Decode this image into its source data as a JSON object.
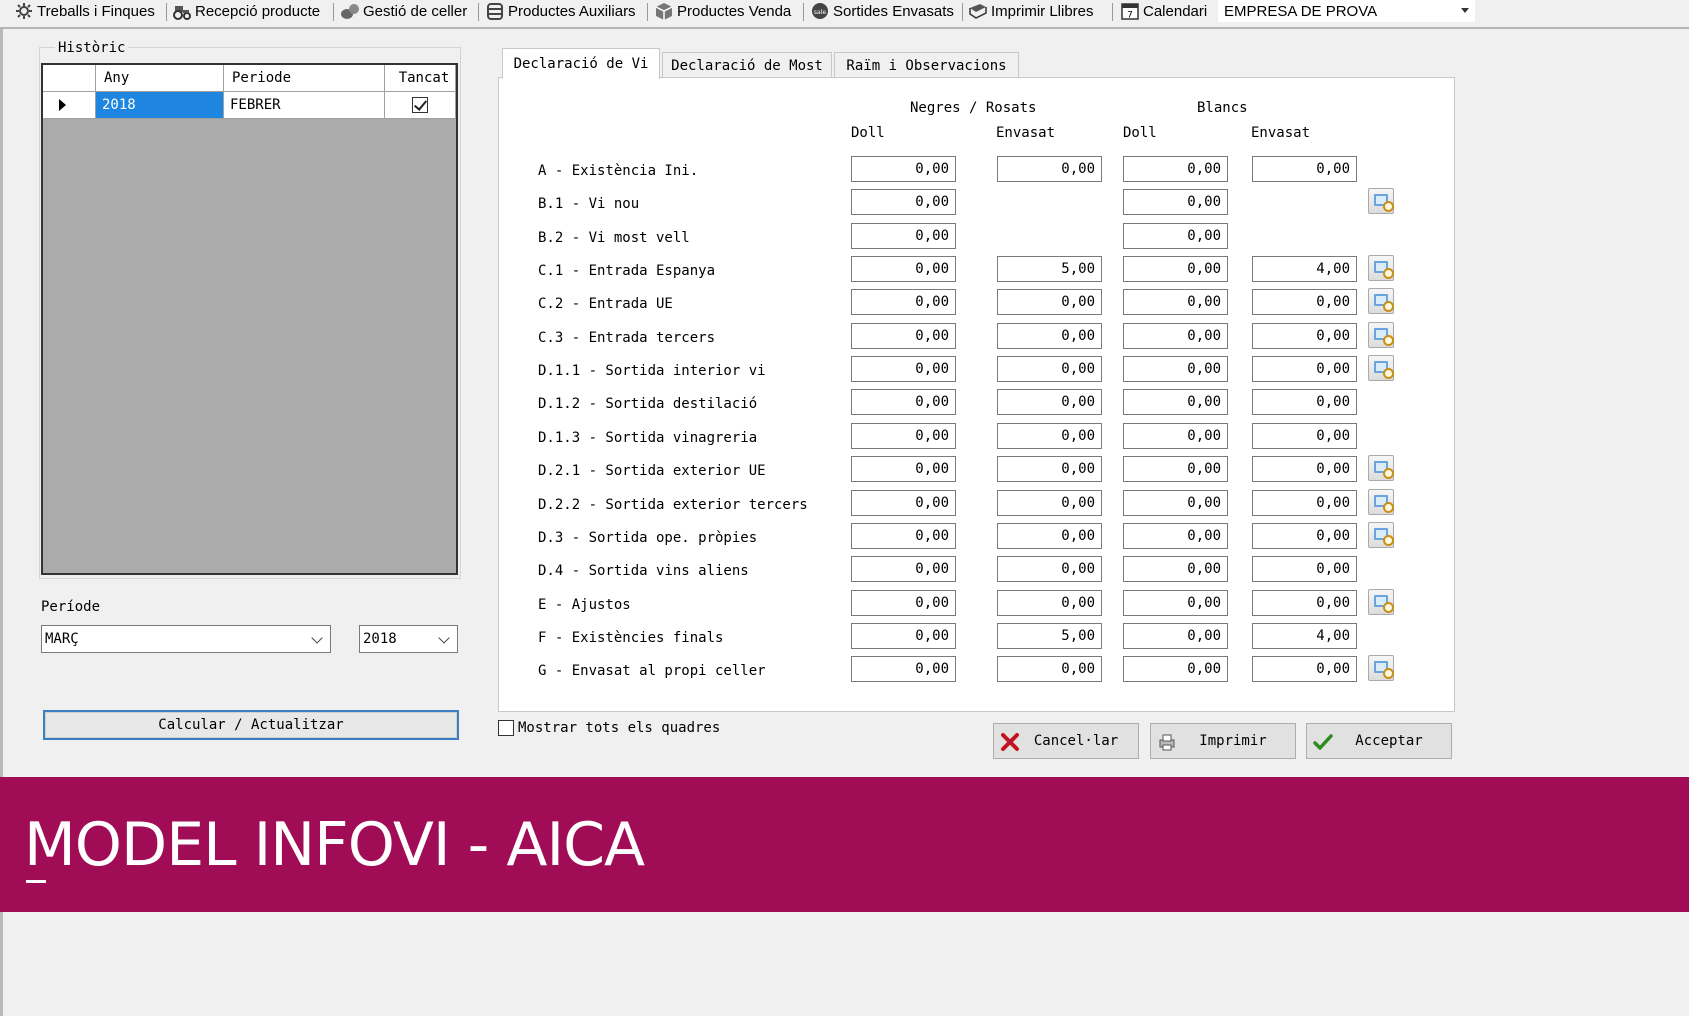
{
  "toolbar": {
    "items": [
      {
        "label": "Treballs i Finques",
        "icon": "gear-leaf-icon"
      },
      {
        "label": "Recepció producte",
        "icon": "tractor-icon"
      },
      {
        "label": "Gestió de celler",
        "icon": "barrels-icon"
      },
      {
        "label": "Productes Auxiliars",
        "icon": "container-icon"
      },
      {
        "label": "Productes Venda",
        "icon": "box-icon"
      },
      {
        "label": "Sortides Envasats",
        "icon": "sale-icon"
      },
      {
        "label": "Imprimir Llibres",
        "icon": "book-icon"
      },
      {
        "label": "Calendari",
        "icon": "calendar-icon",
        "calendar_day": "7"
      }
    ],
    "company": "EMPRESA DE PROVA"
  },
  "historic": {
    "title": "Històric",
    "headers": [
      "Any",
      "Periode",
      "Tancat"
    ],
    "rows": [
      {
        "year": "2018",
        "period": "FEBRER",
        "closed": true
      }
    ]
  },
  "periode": {
    "label": "Període",
    "month": "MARÇ",
    "year": "2018"
  },
  "calc_button": "Calcular / Actualitzar",
  "tabs": [
    "Declaració de Vi",
    "Declaració de Most",
    "Raïm i Observacions"
  ],
  "declaration": {
    "group_headers": [
      "Negres / Rosats",
      "Blancs"
    ],
    "column_headers": [
      "Doll",
      "Envasat",
      "Doll",
      "Envasat"
    ],
    "rows": [
      {
        "label": "A - Existència Ini.",
        "values": [
          "0,00",
          "0,00",
          "0,00",
          "0,00"
        ],
        "lookup": false
      },
      {
        "label": "B.1 - Vi nou",
        "values": [
          "0,00",
          null,
          "0,00",
          null
        ],
        "lookup": true
      },
      {
        "label": "B.2 - Vi most vell",
        "values": [
          "0,00",
          null,
          "0,00",
          null
        ],
        "lookup": false
      },
      {
        "label": "C.1 - Entrada Espanya",
        "values": [
          "0,00",
          "5,00",
          "0,00",
          "4,00"
        ],
        "lookup": true
      },
      {
        "label": "C.2 - Entrada UE",
        "values": [
          "0,00",
          "0,00",
          "0,00",
          "0,00"
        ],
        "lookup": true
      },
      {
        "label": "C.3 - Entrada tercers",
        "values": [
          "0,00",
          "0,00",
          "0,00",
          "0,00"
        ],
        "lookup": true
      },
      {
        "label": "D.1.1 - Sortida interior vi",
        "values": [
          "0,00",
          "0,00",
          "0,00",
          "0,00"
        ],
        "lookup": true
      },
      {
        "label": "D.1.2 - Sortida destilació",
        "values": [
          "0,00",
          "0,00",
          "0,00",
          "0,00"
        ],
        "lookup": false
      },
      {
        "label": "D.1.3 - Sortida vinagreria",
        "values": [
          "0,00",
          "0,00",
          "0,00",
          "0,00"
        ],
        "lookup": false
      },
      {
        "label": "D.2.1 - Sortida exterior UE",
        "values": [
          "0,00",
          "0,00",
          "0,00",
          "0,00"
        ],
        "lookup": true
      },
      {
        "label": "D.2.2 - Sortida exterior tercers",
        "values": [
          "0,00",
          "0,00",
          "0,00",
          "0,00"
        ],
        "lookup": true
      },
      {
        "label": "D.3 - Sortida ope. pròpies",
        "values": [
          "0,00",
          "0,00",
          "0,00",
          "0,00"
        ],
        "lookup": true
      },
      {
        "label": "D.4 - Sortida vins aliens",
        "values": [
          "0,00",
          "0,00",
          "0,00",
          "0,00"
        ],
        "lookup": false
      },
      {
        "label": "E - Ajustos",
        "values": [
          "0,00",
          "0,00",
          "0,00",
          "0,00"
        ],
        "lookup": true
      },
      {
        "label": "F - Existències finals",
        "values": [
          "0,00",
          "5,00",
          "0,00",
          "4,00"
        ],
        "lookup": false
      },
      {
        "label": "G - Envasat al propi celler",
        "values": [
          "0,00",
          "0,00",
          "0,00",
          "0,00"
        ],
        "lookup": true
      }
    ]
  },
  "show_all_label": "Mostrar tots els quadres",
  "buttons": {
    "cancel": "Cancel·lar",
    "print": "Imprimir",
    "accept": "Acceptar"
  },
  "banner": {
    "title": "MODEL INFOVI - AICA",
    "color": "#a10c56"
  },
  "colors": {
    "selection": "#1e86e0",
    "focus_border": "#3c7fc1"
  }
}
